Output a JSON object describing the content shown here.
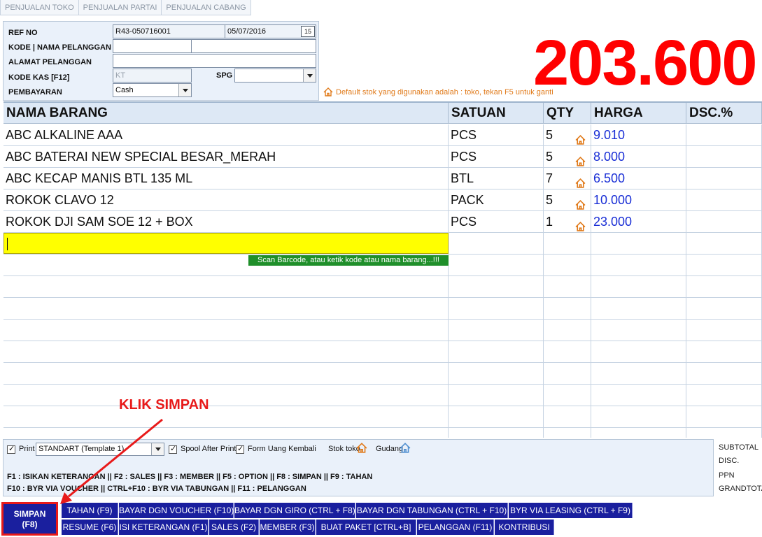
{
  "tabs": [
    "PENJUALAN TOKO",
    "PENJUALAN PARTAI",
    "PENJUALAN CABANG"
  ],
  "header": {
    "ref_no_label": "REF NO",
    "ref_no_value": "R43-050716001",
    "date_value": "05/07/2016",
    "calendar_glyph": "15",
    "kode_pelanggan_label": "KODE | NAMA PELANGGAN",
    "alamat_label": "ALAMAT PELANGGAN",
    "kode_kas_label": "KODE KAS [F12]",
    "kode_kas_value": "KT",
    "spg_label": "SPG",
    "pembayaran_label": "PEMBAYARAN",
    "pembayaran_value": "Cash"
  },
  "total": "203.600",
  "stock_note": "Default stok yang digunakan adalah : toko, tekan F5 untuk ganti",
  "table": {
    "columns": [
      "NAMA BARANG",
      "SATUAN",
      "QTY",
      "HARGA",
      "DSC.%"
    ],
    "rows": [
      {
        "name": "ABC ALKALINE AAA",
        "satuan": "PCS",
        "qty": "5",
        "harga": "9.010",
        "dsc": ""
      },
      {
        "name": "ABC BATERAI NEW SPECIAL BESAR_MERAH",
        "satuan": "PCS",
        "qty": "5",
        "harga": "8.000",
        "dsc": ""
      },
      {
        "name": "ABC KECAP MANIS BTL 135 ML",
        "satuan": "BTL",
        "qty": "7",
        "harga": "6.500",
        "dsc": ""
      },
      {
        "name": "ROKOK CLAVO 12",
        "satuan": "PACK",
        "qty": "5",
        "harga": "10.000",
        "dsc": ""
      },
      {
        "name": "ROKOK DJI SAM SOE 12 + BOX",
        "satuan": "PCS",
        "qty": "1",
        "harga": "23.000",
        "dsc": ""
      }
    ],
    "scan_hint": "Scan Barcode, atau ketik kode atau nama barang...!!!"
  },
  "options": {
    "print_label": "Print",
    "template_value": "STANDART (Template 1)",
    "spool_label": "Spool After Print",
    "form_uang_label": "Form Uang Kembali",
    "stok_toko_label": "Stok toko",
    "gudang_label": "Gudang",
    "shortcuts_line1": "F1 : ISIKAN KETERANGAN || F2 : SALES || F3 : MEMBER || F5 : OPTION || F8 : SIMPAN || F9 : TAHAN",
    "shortcuts_line2": "F10 : BYR VIA VOUCHER || CTRL+F10 : BYR VIA TABUNGAN || F11 : PELANGGAN"
  },
  "summary": {
    "subtotal": "SUBTOTAL",
    "disc": "DISC.",
    "ppn": "PPN",
    "grandtotal": "GRANDTOTAL"
  },
  "buttons": {
    "simpan_line1": "SIMPAN",
    "simpan_line2": "(F8)",
    "row1": [
      "TAHAN (F9)",
      "BAYAR DGN VOUCHER (F10)",
      "BAYAR DGN GIRO (CTRL + F8)",
      "BAYAR DGN TABUNGAN (CTRL + F10)",
      "BYR VIA LEASING (CTRL + F9)"
    ],
    "row2": [
      "RESUME (F6)",
      "ISI KETERANGAN (F1)",
      "SALES (F2)",
      "MEMBER (F3)",
      "BUAT PAKET [CTRL+B]",
      "PELANGGAN (F11)",
      "KONTRIBUSI"
    ]
  },
  "annotation": "KLIK SIMPAN",
  "colors": {
    "total_red": "#ff0000",
    "button_blue": "#1a1f9e",
    "price_blue": "#1a2fd6",
    "scan_yellow": "#ffff00",
    "hint_green": "#1f8f2a",
    "note_orange": "#e07a1a",
    "annotation_red": "#e81a1a"
  }
}
